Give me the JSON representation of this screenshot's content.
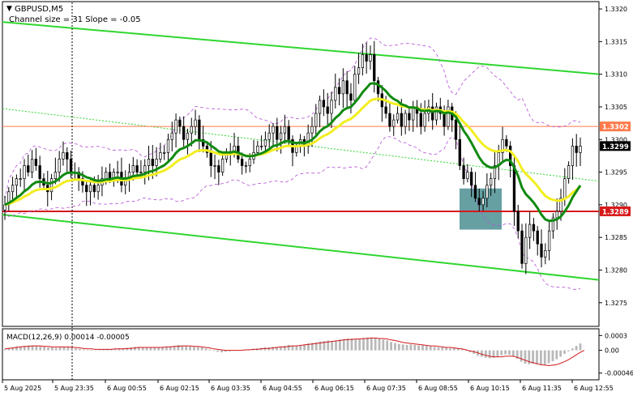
{
  "header": {
    "symbol_label": "GBPUSD,M5",
    "indicator_label": "Channel size = 31 Slope = -0.05",
    "dropdown_arrow": "▼"
  },
  "macd_label": "MACD(12,26,9) 0.00014 -0.00005",
  "colors": {
    "background": "#ffffff",
    "up_candle": "#000000",
    "down_candle": "#000000",
    "channel": "#2fd62f",
    "ema_fast": "#f2ee20",
    "ema_slow": "#118a11",
    "bollinger": "#b44fd4",
    "level": "#d61a1a",
    "resistance": "#ff7a4a",
    "zone": "#4b8f93",
    "macd_hist": "#b9b9b9",
    "macd_signal": "#d31a1a"
  },
  "price_labels": {
    "level_support": "1.3289",
    "level_resistance": "1.3302",
    "current": "1.3299"
  },
  "chart_data": [
    {
      "type": "candlestick",
      "title": "GBPUSD,M5",
      "subtitle": "Channel size = 31 Slope = -0.05",
      "ylim": [
        1.32715,
        1.3321
      ],
      "yticks": [
        "1.3320",
        "1.3315",
        "1.3310",
        "1.3305",
        "1.3300",
        "1.3295",
        "1.3290",
        "1.3285",
        "1.3280",
        "1.3275"
      ],
      "x_labels": [
        "5 Aug 2025",
        "5 Aug 23:35",
        "6 Aug 00:55",
        "6 Aug 02:15",
        "6 Aug 03:35",
        "6 Aug 04:55",
        "6 Aug 06:15",
        "6 Aug 07:35",
        "6 Aug 08:55",
        "6 Aug 10:15",
        "6 Aug 11:35",
        "6 Aug 12:55"
      ],
      "close": [
        1.329,
        1.3292,
        1.3293,
        1.3294,
        1.3294,
        1.3296,
        1.3295,
        1.3297,
        1.3296,
        1.3294,
        1.3293,
        1.3292,
        1.3294,
        1.3295,
        1.3297,
        1.3298,
        1.3297,
        1.3295,
        1.3295,
        1.3294,
        1.3293,
        1.3292,
        1.3293,
        1.3292,
        1.3293,
        1.3294,
        1.3295,
        1.3294,
        1.3295,
        1.3295,
        1.3293,
        1.3294,
        1.3295,
        1.3296,
        1.3295,
        1.3295,
        1.3296,
        1.3297,
        1.3296,
        1.3297,
        1.3298,
        1.3298,
        1.33,
        1.3301,
        1.3303,
        1.3302,
        1.33,
        1.3301,
        1.3302,
        1.3303,
        1.33,
        1.3299,
        1.3298,
        1.3296,
        1.3296,
        1.3295,
        1.3297,
        1.3298,
        1.3298,
        1.3299,
        1.3297,
        1.3296,
        1.3296,
        1.3297,
        1.3298,
        1.3299,
        1.3299,
        1.33,
        1.3301,
        1.3302,
        1.33,
        1.3301,
        1.3302,
        1.33,
        1.3298,
        1.3299,
        1.33,
        1.3299,
        1.3301,
        1.3302,
        1.3304,
        1.3306,
        1.3305,
        1.3304,
        1.3306,
        1.3308,
        1.3307,
        1.3309,
        1.3307,
        1.3306,
        1.331,
        1.3311,
        1.3313,
        1.3312,
        1.3313,
        1.3309,
        1.3307,
        1.3305,
        1.3304,
        1.3302,
        1.3303,
        1.3304,
        1.3302,
        1.3304,
        1.3303,
        1.3305,
        1.3304,
        1.3302,
        1.3304,
        1.3305,
        1.3303,
        1.3305,
        1.3304,
        1.3302,
        1.3305,
        1.3303,
        1.33,
        1.3296,
        1.3294,
        1.3295,
        1.3293,
        1.3291,
        1.329,
        1.3291,
        1.3293,
        1.3294,
        1.3296,
        1.3298,
        1.33,
        1.3299,
        1.3296,
        1.3289,
        1.3286,
        1.3281,
        1.3285,
        1.3287,
        1.3286,
        1.3284,
        1.3282,
        1.3283,
        1.3286,
        1.3288,
        1.3289,
        1.3291,
        1.3294,
        1.3296,
        1.3299,
        1.3298,
        1.3299
      ],
      "series": [
        {
          "name": "Channel",
          "values": []
        }
      ],
      "channel_upper": {
        "start": 1.3318,
        "end": 1.331
      },
      "channel_lower": {
        "start": 1.32885,
        "end": 1.32785
      },
      "horizontal_levels": [
        1.3302,
        1.3289
      ],
      "support_zone": {
        "low": 1.32862,
        "high": 1.32925
      },
      "grid": false
    },
    {
      "type": "bar",
      "title": "MACD(12,26,9) 0.00014 -0.00005",
      "ylim": [
        -0.00058,
        0.00042
      ],
      "yticks": [
        "0.0003",
        "0.00",
        "-0.00046"
      ],
      "histogram": [
        2e-05,
        5e-05,
        6e-05,
        8e-05,
        8e-05,
        9e-05,
        0.0001,
        0.0001,
        9e-05,
        8e-05,
        7e-05,
        6e-05,
        6e-05,
        5e-05,
        6e-05,
        7e-05,
        6e-05,
        5e-05,
        4e-05,
        3e-05,
        2e-05,
        1e-05,
        1e-05,
        0.0,
        1e-05,
        2e-05,
        3e-05,
        2e-05,
        3e-05,
        4e-05,
        4e-05,
        5e-05,
        6e-05,
        7e-05,
        7e-05,
        6e-05,
        6e-05,
        5e-05,
        6e-05,
        6e-05,
        7e-05,
        7e-05,
        8e-05,
        9e-05,
        0.00011,
        0.0001,
        9e-05,
        8e-05,
        7e-05,
        7e-05,
        6e-05,
        4e-05,
        2e-05,
        -1e-05,
        -3e-05,
        -4e-05,
        -3e-05,
        -2e-05,
        -1e-05,
        0.0,
        1e-05,
        2e-05,
        2e-05,
        3e-05,
        4e-05,
        5e-05,
        6e-05,
        6e-05,
        7e-05,
        7e-05,
        8e-05,
        9e-05,
        0.00011,
        0.0001,
        9e-05,
        0.0001,
        0.00012,
        0.00014,
        0.00015,
        0.00016,
        0.00018,
        0.00019,
        0.0002,
        0.00019,
        0.0002,
        0.00022,
        0.00023,
        0.00024,
        0.00024,
        0.00023,
        0.00024,
        0.00025,
        0.00026,
        0.00026,
        0.00025,
        0.00024,
        0.00022,
        0.0002,
        0.00017,
        0.00015,
        0.00013,
        0.00012,
        0.00011,
        0.00012,
        0.00011,
        0.0001,
        0.0001,
        9e-05,
        8e-05,
        7e-05,
        6e-05,
        6e-05,
        5e-05,
        4e-05,
        5e-05,
        4e-05,
        2e-05,
        0.0,
        -4e-05,
        -7e-05,
        -0.00011,
        -0.00013,
        -0.00015,
        -0.00016,
        -0.00015,
        -0.00013,
        -0.0001,
        -8e-05,
        -9e-05,
        -0.00012,
        -0.00017,
        -0.00023,
        -0.00027,
        -0.00028,
        -0.00027,
        -0.00028,
        -0.0003,
        -0.00029,
        -0.00026,
        -0.00022,
        -0.00018,
        -0.00013,
        -7e-05,
        -2e-05,
        4e-05,
        9e-05,
        0.00014
      ],
      "signal": [
        3e-05,
        4e-05,
        5e-05,
        6e-05,
        7e-05,
        8e-05,
        8e-05,
        9e-05,
        9e-05,
        9e-05,
        8e-05,
        8e-05,
        7e-05,
        7e-05,
        7e-05,
        7e-05,
        7e-05,
        6e-05,
        6e-05,
        5e-05,
        4e-05,
        3e-05,
        3e-05,
        2e-05,
        2e-05,
        2e-05,
        2e-05,
        2e-05,
        3e-05,
        3e-05,
        3e-05,
        4e-05,
        4e-05,
        5e-05,
        6e-05,
        6e-05,
        6e-05,
        6e-05,
        6e-05,
        6e-05,
        6e-05,
        7e-05,
        7e-05,
        8e-05,
        8e-05,
        9e-05,
        9e-05,
        9e-05,
        8e-05,
        8e-05,
        7e-05,
        6e-05,
        5e-05,
        3e-05,
        2e-05,
        1e-05,
        0.0,
        0.0,
        0.0,
        0.0,
        0.0,
        1e-05,
        1e-05,
        2e-05,
        2e-05,
        3e-05,
        4e-05,
        4e-05,
        5e-05,
        6e-05,
        7e-05,
        7e-05,
        8e-05,
        9e-05,
        9e-05,
        0.0001,
        0.00011,
        0.00012,
        0.00013,
        0.00014,
        0.00015,
        0.00016,
        0.00017,
        0.00018,
        0.00019,
        0.0002,
        0.00021,
        0.00022,
        0.00022,
        0.00023,
        0.00023,
        0.00024,
        0.00024,
        0.00025,
        0.00025,
        0.00024,
        0.00024,
        0.00023,
        0.00021,
        0.0002,
        0.00018,
        0.00016,
        0.00015,
        0.00014,
        0.00013,
        0.00012,
        0.00011,
        0.0001,
        9e-05,
        9e-05,
        8e-05,
        7e-05,
        6e-05,
        6e-05,
        5e-05,
        4e-05,
        3e-05,
        1e-05,
        -1e-05,
        -3e-05,
        -5e-05,
        -8e-05,
        -0.0001,
        -0.00012,
        -0.00013,
        -0.00013,
        -0.00013,
        -0.00012,
        -0.00012,
        -0.00012,
        -0.00014,
        -0.00017,
        -0.0002,
        -0.00023,
        -0.00025,
        -0.00027,
        -0.00029,
        -0.0003,
        -0.00031,
        -0.0003,
        -0.00029,
        -0.00026,
        -0.00023,
        -0.00019,
        -0.00014,
        -9e-05,
        -4e-05,
        0.0
      ],
      "grid": false
    }
  ]
}
